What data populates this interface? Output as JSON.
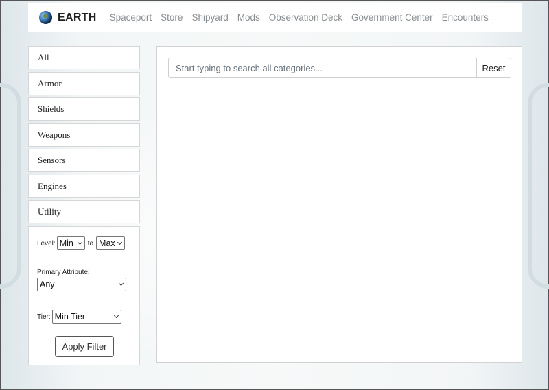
{
  "brand": {
    "name": "EARTH",
    "icon": "planet-earth-icon"
  },
  "nav": {
    "links": [
      "Spaceport",
      "Store",
      "Shipyard",
      "Mods",
      "Observation Deck",
      "Government Center",
      "Encounters"
    ]
  },
  "sidebar": {
    "categories": [
      "All",
      "Armor",
      "Shields",
      "Weapons",
      "Sensors",
      "Engines",
      "Utility"
    ]
  },
  "filters": {
    "level_label": "Level:",
    "level_min": "Min",
    "level_to": "to",
    "level_max": "Max",
    "attribute_label": "Primary Attribute:",
    "attribute_value": "Any",
    "tier_label": "Tier:",
    "tier_value": "Min Tier",
    "apply_label": "Apply Filter"
  },
  "search": {
    "placeholder": "Start typing to search all categories...",
    "value": "",
    "reset_label": "Reset"
  }
}
